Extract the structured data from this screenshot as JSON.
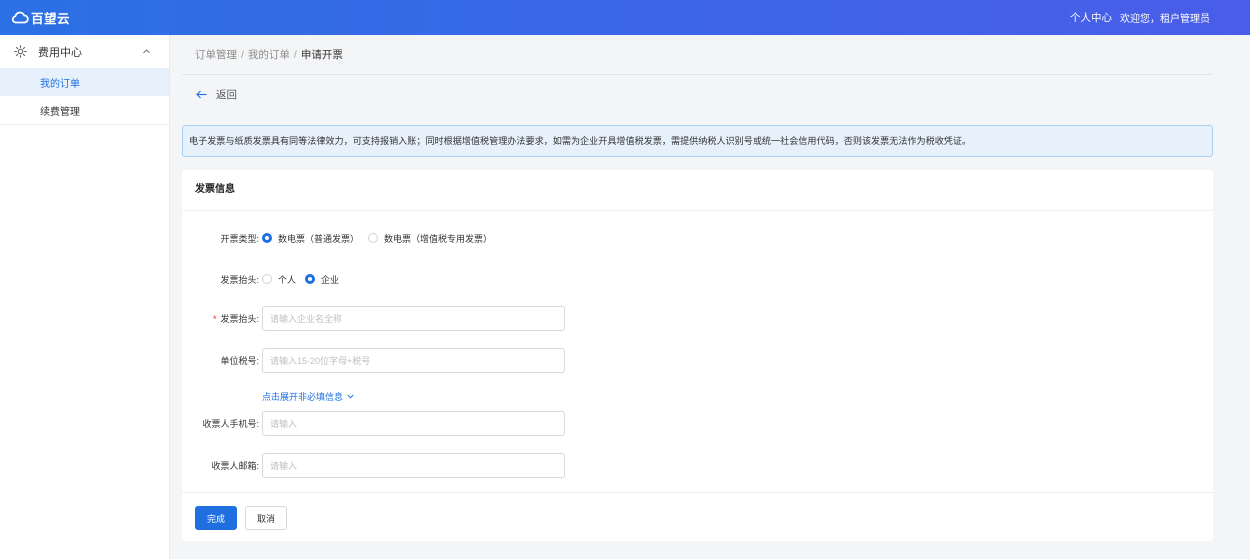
{
  "header": {
    "logo_icon": "cloud-icon",
    "logo_text": "百望云",
    "user_center": "个人中心",
    "welcome": "欢迎您，租户管理员"
  },
  "sidebar": {
    "group": {
      "icon": "sun-icon",
      "label": "费用中心",
      "expanded": true,
      "toggle_icon": "chevron-up-icon"
    },
    "items": [
      {
        "label": "我的订单",
        "active": true
      },
      {
        "label": "续费管理",
        "active": false
      }
    ]
  },
  "breadcrumb": {
    "separator": "/",
    "items": [
      "订单管理",
      "我的订单",
      "申请开票"
    ]
  },
  "back": {
    "icon": "arrow-left-icon",
    "label": "返回"
  },
  "notice": {
    "text": "电子发票与纸质发票具有同等法律效力，可支持报销入账；同时根据增值税管理办法要求，如需为企业开具增值税发票，需提供纳税人识别号或统一社会信用代码，否则该发票无法作为税收凭证。"
  },
  "form": {
    "section_title": "发票信息",
    "invoice_type": {
      "label": "开票类型:",
      "options": [
        {
          "label": "数电票（普通发票）",
          "checked": true
        },
        {
          "label": "数电票（增值税专用发票）",
          "checked": false
        }
      ]
    },
    "title_type": {
      "label": "发票抬头:",
      "options": [
        {
          "label": "个人",
          "checked": false
        },
        {
          "label": "企业",
          "checked": true
        }
      ]
    },
    "company_name": {
      "required_mark": "*",
      "label": "发票抬头:",
      "placeholder": "请输入企业名全称",
      "value": ""
    },
    "tax_id": {
      "label": "单位税号:",
      "placeholder": "请输入15-20位字母+税号",
      "value": ""
    },
    "expand_link": {
      "label": "点击展开非必填信息",
      "icon": "chevron-down-icon"
    },
    "phone": {
      "label": "收票人手机号:",
      "placeholder": "请输入",
      "value": ""
    },
    "email": {
      "label": "收票人邮箱:",
      "placeholder": "请输入",
      "value": ""
    }
  },
  "actions": {
    "submit": "完成",
    "cancel": "取消"
  },
  "colors": {
    "primary": "#1f6fe0",
    "header_gradient_start": "#2b70e4",
    "header_gradient_end": "#4a5de8",
    "page_bg": "#f4f5f7",
    "alert_bg": "#e6f1fc",
    "alert_border": "#a8cff3",
    "required": "#f5222d",
    "active_menu_bg": "#e7f1fc"
  }
}
